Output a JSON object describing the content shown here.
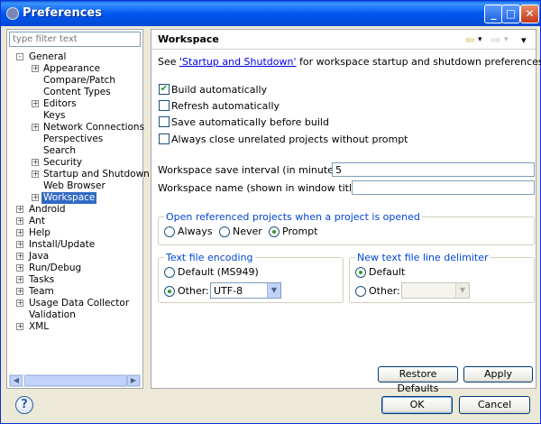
{
  "window": {
    "title": "Preferences"
  },
  "filter": {
    "placeholder": "type filter text"
  },
  "tree": [
    {
      "label": "General",
      "toggle": "−",
      "level": 0
    },
    {
      "label": "Appearance",
      "toggle": "+",
      "level": 1
    },
    {
      "label": "Compare/Patch",
      "toggle": "",
      "level": 1
    },
    {
      "label": "Content Types",
      "toggle": "",
      "level": 1
    },
    {
      "label": "Editors",
      "toggle": "+",
      "level": 1
    },
    {
      "label": "Keys",
      "toggle": "",
      "level": 1
    },
    {
      "label": "Network Connections",
      "toggle": "+",
      "level": 1
    },
    {
      "label": "Perspectives",
      "toggle": "",
      "level": 1
    },
    {
      "label": "Search",
      "toggle": "",
      "level": 1
    },
    {
      "label": "Security",
      "toggle": "+",
      "level": 1
    },
    {
      "label": "Startup and Shutdown",
      "toggle": "+",
      "level": 1
    },
    {
      "label": "Web Browser",
      "toggle": "",
      "level": 1
    },
    {
      "label": "Workspace",
      "toggle": "+",
      "level": 1,
      "selected": true
    },
    {
      "label": "Android",
      "toggle": "+",
      "level": 0
    },
    {
      "label": "Ant",
      "toggle": "+",
      "level": 0
    },
    {
      "label": "Help",
      "toggle": "+",
      "level": 0
    },
    {
      "label": "Install/Update",
      "toggle": "+",
      "level": 0
    },
    {
      "label": "Java",
      "toggle": "+",
      "level": 0
    },
    {
      "label": "Run/Debug",
      "toggle": "+",
      "level": 0
    },
    {
      "label": "Tasks",
      "toggle": "+",
      "level": 0
    },
    {
      "label": "Team",
      "toggle": "+",
      "level": 0
    },
    {
      "label": "Usage Data Collector",
      "toggle": "+",
      "level": 0
    },
    {
      "label": "Validation",
      "toggle": "",
      "level": 0
    },
    {
      "label": "XML",
      "toggle": "+",
      "level": 0
    }
  ],
  "page": {
    "title": "Workspace",
    "intro_prefix": "See ",
    "intro_link": "'Startup and Shutdown'",
    "intro_suffix": " for workspace startup and shutdown preferences.",
    "checkboxes": [
      {
        "label": "Build automatically",
        "checked": true
      },
      {
        "label": "Refresh automatically",
        "checked": false
      },
      {
        "label": "Save automatically before build",
        "checked": false
      },
      {
        "label": "Always close unrelated projects without prompt",
        "checked": false
      }
    ],
    "save_interval_label": "Workspace save interval (in minutes):",
    "save_interval_value": "5",
    "workspace_name_label": "Workspace name (shown in window title):",
    "workspace_name_value": "",
    "open_projects": {
      "title": "Open referenced projects when a project is opened",
      "options": [
        "Always",
        "Never",
        "Prompt"
      ],
      "selected": "Prompt"
    },
    "encoding": {
      "title": "Text file encoding",
      "default_label": "Default (MS949)",
      "other_label": "Other:",
      "selected": "Other",
      "other_value": "UTF-8"
    },
    "delimiter": {
      "title": "New text file line delimiter",
      "default_label": "Default",
      "other_label": "Other:",
      "selected": "Default",
      "other_value": ""
    },
    "restore_defaults": "Restore Defaults",
    "apply": "Apply"
  },
  "footer": {
    "ok": "OK",
    "cancel": "Cancel",
    "help_icon": "?"
  },
  "icons": {
    "back": "⇦",
    "forward": "⇨",
    "menu": "▾"
  }
}
